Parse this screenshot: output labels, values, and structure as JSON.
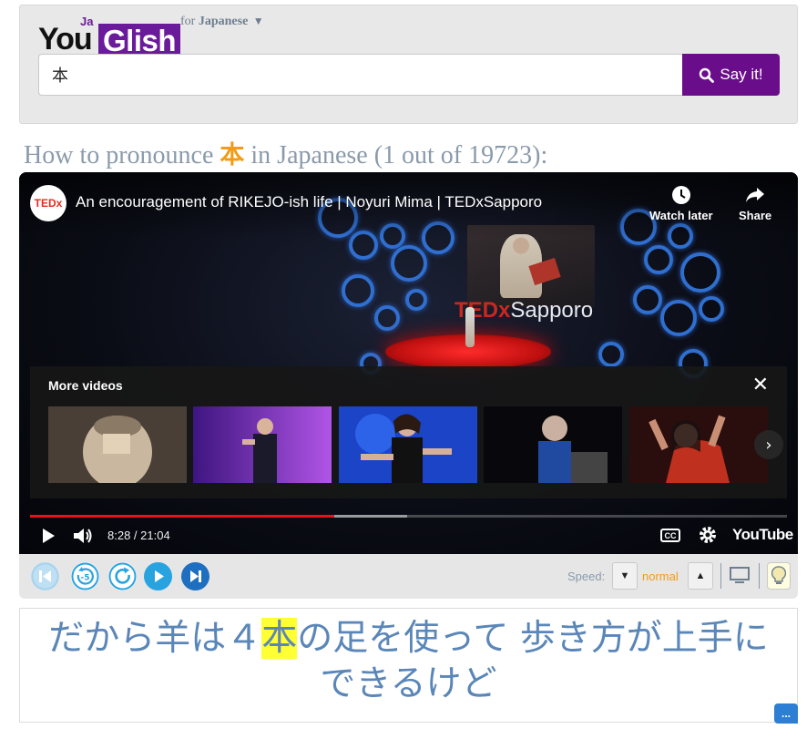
{
  "header": {
    "logo_you": "You",
    "logo_ja": "Ja",
    "logo_glish": "Glish",
    "lang_prefix": "for",
    "lang_name": "Japanese",
    "lang_caret": "▼"
  },
  "search": {
    "value": "本",
    "button_label": "Say it!"
  },
  "pronounce": {
    "prefix": "How to pronounce",
    "word": "本",
    "suffix": "in Japanese (1 out of 19723):"
  },
  "video": {
    "channel": "TEDx",
    "title": "An encouragement of RIKEJO-ish life | Noyuri Mima | TEDxSapporo",
    "watch_later": "Watch later",
    "share": "Share",
    "stage_sign_red": "TEDx",
    "stage_sign_white": "Sapporo",
    "more_videos_title": "More videos",
    "more_close": "✕",
    "more_next": "›",
    "time": "8:28 / 21:04",
    "played_fraction": 0.402,
    "buffered_fraction": 0.498,
    "cc": "CC",
    "youtube": "YouTube",
    "thumbnails": [
      {
        "name": "thumb-1",
        "colors": [
          "#6b5a4a",
          "#c9b89f"
        ]
      },
      {
        "name": "thumb-2",
        "colors": [
          "#5a1d9c",
          "#b055e6"
        ]
      },
      {
        "name": "thumb-3",
        "colors": [
          "#1b44c7",
          "#4a8cff"
        ]
      },
      {
        "name": "thumb-4",
        "colors": [
          "#0a0a0f",
          "#2a2a3a"
        ]
      },
      {
        "name": "thumb-5",
        "colors": [
          "#7a1b14",
          "#e0603a"
        ]
      }
    ]
  },
  "controls": {
    "speed_label": "Speed:",
    "speed_value": "normal",
    "speed_down": "▼",
    "speed_up": "▲"
  },
  "caption": {
    "before": "だから羊は４",
    "highlight": "本",
    "after_line1": "の足を使って 歩き方が上手に",
    "line2": "できるけど"
  },
  "chat_label": "...",
  "colors": {
    "brand_purple": "#6a0d8a",
    "accent_orange": "#f39c12",
    "caption_blue": "#5a86b8",
    "highlight_yellow": "#ffff33",
    "progress_red": "#e11"
  }
}
